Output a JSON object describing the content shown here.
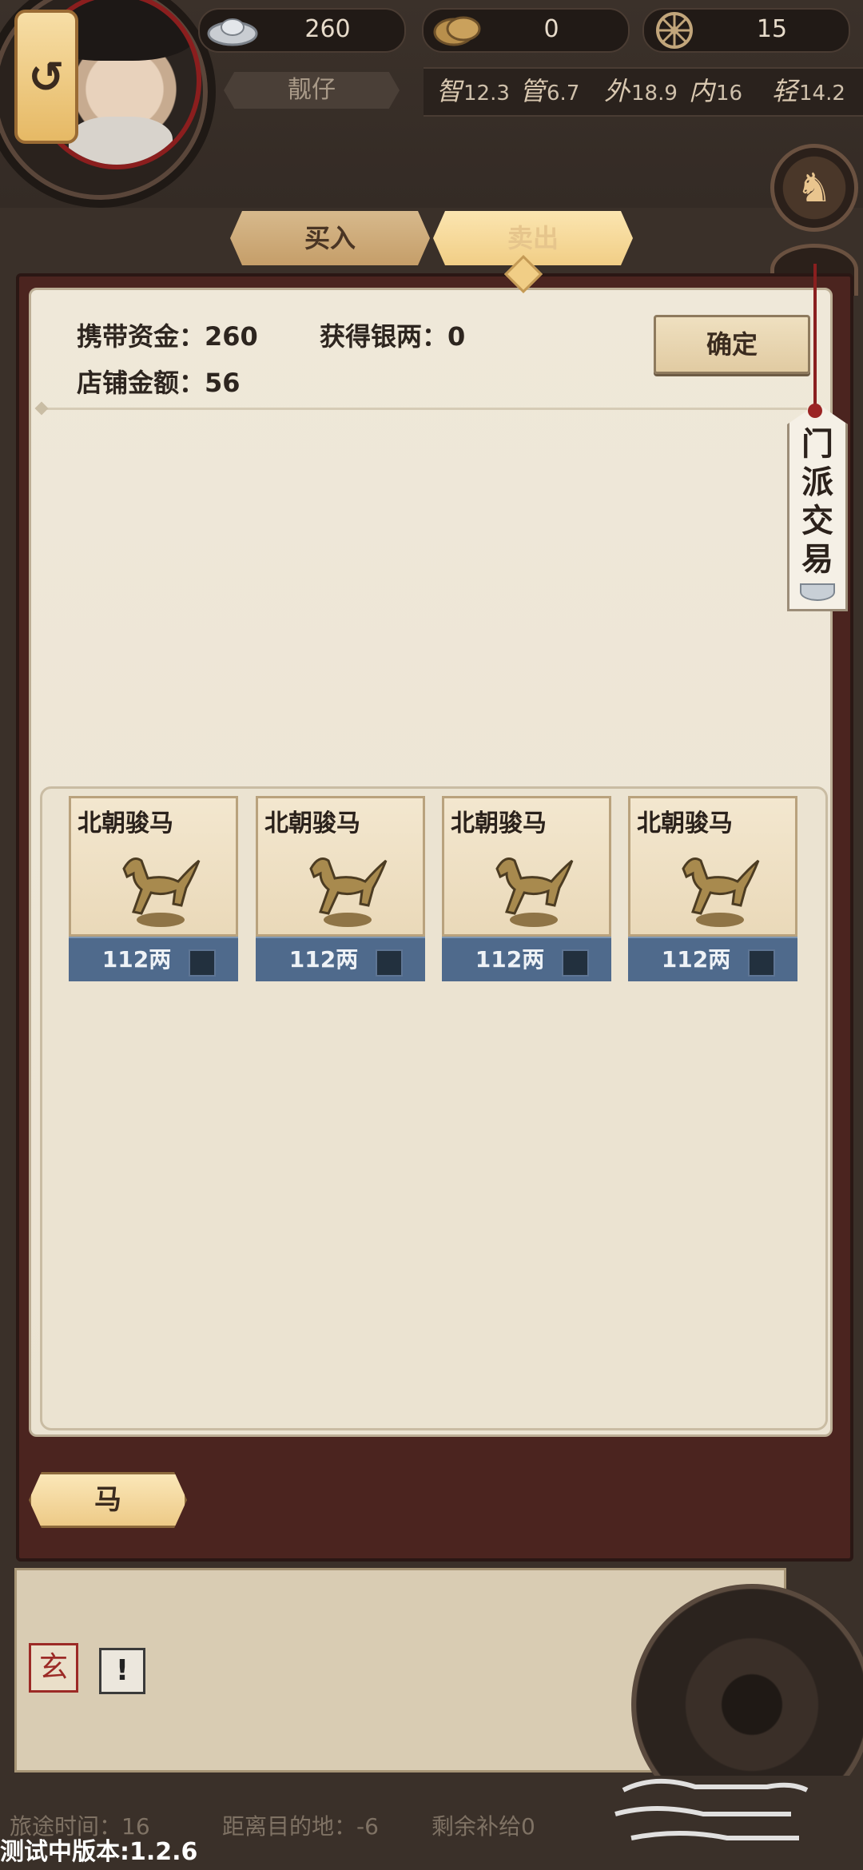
{
  "hud": {
    "back_icon": "undo-arrow-icon",
    "back_glyph": "↺",
    "silver_value": "260",
    "coin_value": "0",
    "wheel_value": "15",
    "player_name": "靓仔",
    "stats": [
      {
        "key": "智",
        "value": "12.3"
      },
      {
        "key": "管",
        "value": "6.7"
      },
      {
        "key": "外",
        "value": "18.9"
      },
      {
        "key": "内",
        "value": "16"
      },
      {
        "key": "轻",
        "value": "14.2"
      }
    ],
    "horse_medal_glyph": "♞"
  },
  "tabs": {
    "buy": "买入",
    "sell": "卖出",
    "active": "sell"
  },
  "panel": {
    "carry_funds_label": "携带资金：260",
    "silver_gain_label": "获得银两：0",
    "shop_amount_label": "店铺金额：56",
    "confirm_label": "确定",
    "side_tag_chars": [
      "门",
      "派",
      "交",
      "易"
    ]
  },
  "items": [
    {
      "name": "北朝骏马",
      "price": "112两",
      "checked": false,
      "icon": "bronze-horse-icon"
    },
    {
      "name": "北朝骏马",
      "price": "112两",
      "checked": false,
      "icon": "bronze-horse-icon"
    },
    {
      "name": "北朝骏马",
      "price": "112两",
      "checked": false,
      "icon": "bronze-horse-icon"
    },
    {
      "name": "北朝骏马",
      "price": "112两",
      "checked": false,
      "icon": "bronze-horse-icon"
    }
  ],
  "category_button": "马",
  "bottom": {
    "seal_glyph": "玄",
    "warn_glyph": "!",
    "travel_time": "旅途时间：16",
    "distance": "距离目的地：-6",
    "supplies": "剩余补给0",
    "version": "测试中版本:1.2.6"
  },
  "colors": {
    "panel_border": "#4b241f",
    "paper": "#efe8d9",
    "card_footer": "#4f6a8c",
    "tab_active": "#f1ce86",
    "tab_inactive": "#c59e69"
  }
}
